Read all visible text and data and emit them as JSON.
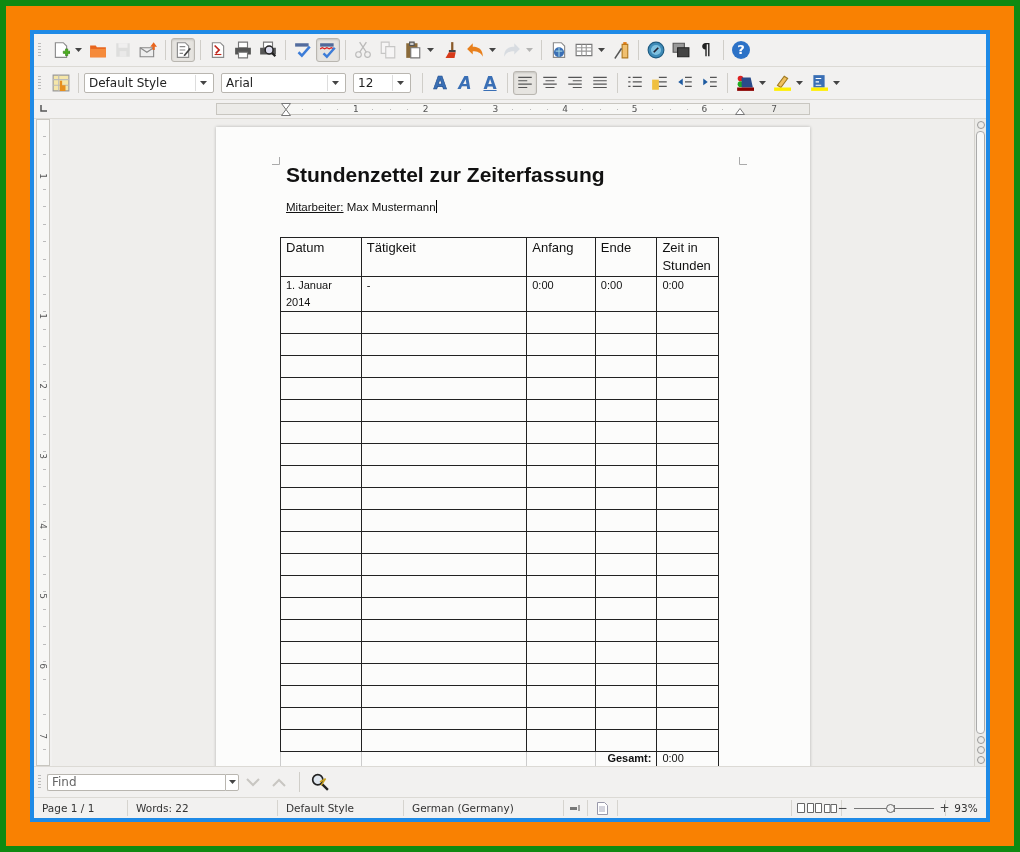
{
  "toolbar_standard": {
    "groups": [
      [
        {
          "kind": "new",
          "on": false,
          "disabled": false,
          "dropdown": true
        },
        {
          "kind": "open",
          "on": false,
          "disabled": false,
          "dropdown": false
        },
        {
          "kind": "save",
          "on": false,
          "disabled": true,
          "dropdown": false
        },
        {
          "kind": "email",
          "on": false,
          "disabled": false,
          "dropdown": false
        }
      ],
      [
        {
          "kind": "edit",
          "on": true,
          "disabled": false,
          "dropdown": false
        }
      ],
      [
        {
          "kind": "pdf",
          "on": false,
          "disabled": false,
          "dropdown": false
        },
        {
          "kind": "print",
          "on": false,
          "disabled": false,
          "dropdown": false
        },
        {
          "kind": "preview",
          "on": false,
          "disabled": false,
          "dropdown": false
        }
      ],
      [
        {
          "kind": "spellcheck",
          "on": false,
          "disabled": false,
          "dropdown": false
        },
        {
          "kind": "autospell",
          "on": true,
          "disabled": false,
          "dropdown": false
        }
      ],
      [
        {
          "kind": "cut",
          "on": false,
          "disabled": true,
          "dropdown": false
        },
        {
          "kind": "copy",
          "on": false,
          "disabled": true,
          "dropdown": false
        },
        {
          "kind": "paste",
          "on": false,
          "disabled": false,
          "dropdown": true
        },
        {
          "kind": "clone",
          "on": false,
          "disabled": false,
          "dropdown": false
        },
        {
          "kind": "undo",
          "on": false,
          "disabled": false,
          "dropdown": true
        },
        {
          "kind": "redo",
          "on": false,
          "disabled": true,
          "dropdown": true
        }
      ],
      [
        {
          "kind": "hyperlink",
          "on": false,
          "disabled": false,
          "dropdown": false
        },
        {
          "kind": "table",
          "on": false,
          "disabled": false,
          "dropdown": true
        },
        {
          "kind": "draw",
          "on": false,
          "disabled": false,
          "dropdown": false
        }
      ],
      [
        {
          "kind": "navigator",
          "on": false,
          "disabled": false,
          "dropdown": false
        },
        {
          "kind": "gallery",
          "on": false,
          "disabled": false,
          "dropdown": false
        },
        {
          "kind": "marks",
          "label": "¶",
          "on": false,
          "disabled": false,
          "dropdown": false
        }
      ],
      [
        {
          "kind": "help",
          "label": "?",
          "on": false,
          "disabled": false,
          "dropdown": false
        }
      ]
    ]
  },
  "toolbar_formatting": {
    "groups": [
      [
        {
          "kind": "styles",
          "on": false,
          "disabled": false,
          "dropdown": false
        }
      ],
      [
        {
          "kind": "combo",
          "value": "Default Style",
          "on": false,
          "disabled": false,
          "dropdown": true
        },
        {
          "kind": "combo",
          "value": "Arial",
          "on": false,
          "disabled": false,
          "dropdown": true
        },
        {
          "kind": "combo",
          "value": "12",
          "on": false,
          "disabled": false,
          "dropdown": true
        }
      ],
      [
        {
          "kind": "bold",
          "label": "A",
          "on": false,
          "disabled": false,
          "dropdown": false
        },
        {
          "kind": "italic",
          "label": "A",
          "on": false,
          "disabled": false,
          "dropdown": false
        },
        {
          "kind": "underline",
          "label": "A",
          "on": false,
          "disabled": false,
          "dropdown": false
        }
      ],
      [
        {
          "kind": "align-left",
          "on": true,
          "disabled": false,
          "dropdown": false
        },
        {
          "kind": "align-center",
          "on": false,
          "disabled": false,
          "dropdown": false
        },
        {
          "kind": "align-right",
          "on": false,
          "disabled": false,
          "dropdown": false
        },
        {
          "kind": "justify",
          "on": false,
          "disabled": false,
          "dropdown": false
        }
      ],
      [
        {
          "kind": "numbering",
          "on": false,
          "disabled": false,
          "dropdown": false
        },
        {
          "kind": "bullets",
          "on": false,
          "disabled": false,
          "dropdown": false
        },
        {
          "kind": "outdent",
          "on": false,
          "disabled": false,
          "dropdown": false
        },
        {
          "kind": "indent",
          "on": false,
          "disabled": false,
          "dropdown": false
        }
      ],
      [
        {
          "kind": "font-color",
          "on": false,
          "disabled": false,
          "dropdown": true
        },
        {
          "kind": "highlight",
          "on": false,
          "disabled": false,
          "dropdown": true
        },
        {
          "kind": "background",
          "on": false,
          "disabled": false,
          "dropdown": true
        }
      ]
    ]
  },
  "ruler": {
    "labels": [
      "1",
      "2",
      "3",
      "4",
      "5",
      "6",
      "7"
    ]
  },
  "vertical_ruler": {
    "labels": [
      "1",
      "1",
      "2",
      "3",
      "4",
      "5",
      "6",
      "7"
    ]
  },
  "document": {
    "title": "Stundenzettel zur Zeiterfassung",
    "employee_label": "Mitarbeiter:",
    "employee_name": "Max Mustermann",
    "table": {
      "columns": [
        "Datum",
        "Tätigkeit",
        "Anfang",
        "Ende",
        "Zeit in Stunden"
      ],
      "rows": [
        {
          "kind": "entry",
          "cells": [
            "1. Januar 2014",
            "-",
            "0:00",
            "0:00",
            "0:00"
          ]
        },
        {
          "kind": "blank"
        },
        {
          "kind": "blank"
        },
        {
          "kind": "blank"
        },
        {
          "kind": "blank"
        },
        {
          "kind": "blank"
        },
        {
          "kind": "blank"
        },
        {
          "kind": "blank"
        },
        {
          "kind": "blank"
        },
        {
          "kind": "blank"
        },
        {
          "kind": "blank"
        },
        {
          "kind": "blank"
        },
        {
          "kind": "blank"
        },
        {
          "kind": "blank"
        },
        {
          "kind": "blank"
        },
        {
          "kind": "blank"
        },
        {
          "kind": "blank"
        },
        {
          "kind": "blank"
        },
        {
          "kind": "blank"
        },
        {
          "kind": "blank"
        },
        {
          "kind": "blank"
        },
        {
          "kind": "total",
          "label": "Gesamt:",
          "value": "0:00"
        }
      ]
    }
  },
  "find_bar": {
    "placeholder": "Find",
    "previous_disabled": true,
    "next_disabled": true
  },
  "status_bar": {
    "page": "Page 1 / 1",
    "words": "Words: 22",
    "style": "Default Style",
    "language": "German (Germany)",
    "zoom": {
      "zoom_out": "−",
      "zoom_in": "+",
      "level": 0.45,
      "reading": "93%"
    }
  }
}
